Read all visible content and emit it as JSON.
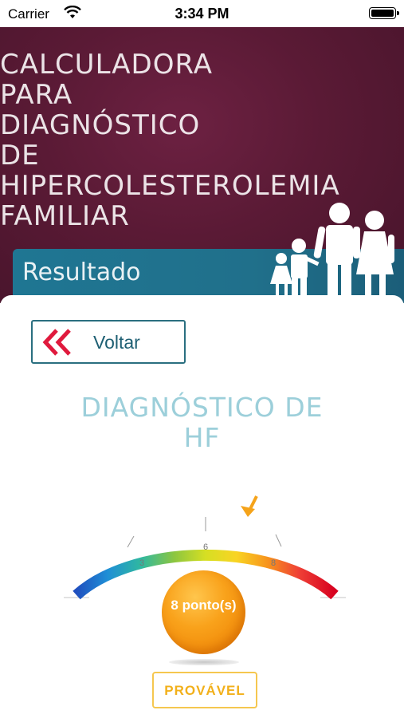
{
  "status_bar": {
    "carrier": "Carrier",
    "time": "3:34 PM"
  },
  "header": {
    "title_lines": [
      "CALCULADORA",
      "PARA",
      "DIAGNÓSTICO",
      "DE",
      "HIPERCOLESTEROLEMIA",
      "FAMILIAR"
    ],
    "result_label": "Resultado"
  },
  "back_button": {
    "label": "Voltar"
  },
  "diagnosis": {
    "title_lines": [
      "DIAGNÓSTICO DE",
      "HF"
    ]
  },
  "gauge": {
    "tick_labels": [
      "3",
      "6",
      "8"
    ],
    "score": 8
  },
  "score": {
    "label": "8 ponto(s)"
  },
  "result": {
    "label": "PROVÁVEL"
  },
  "colors": {
    "header_bg": "#5a1a35",
    "band": "#1f7693",
    "accent_red": "#e0193d",
    "button_border": "#2a6f80",
    "title_teal": "#9ccfda",
    "orange": "#f9a21b"
  }
}
